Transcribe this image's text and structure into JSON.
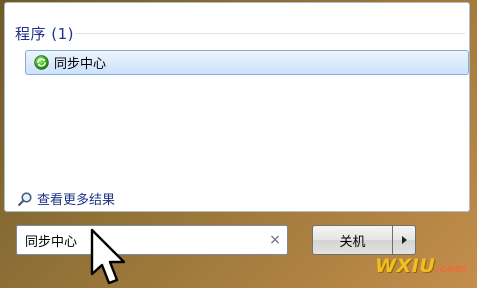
{
  "programs_section": {
    "title": "程序 (1)",
    "items": [
      {
        "label": "同步中心",
        "icon": "sync-center-icon"
      }
    ]
  },
  "see_more": {
    "label": "查看更多结果",
    "icon": "magnifier-icon"
  },
  "search": {
    "value": "同步中心",
    "clear_glyph": "×"
  },
  "shutdown": {
    "label": "关机",
    "arrow_icon": "arrow-right-icon"
  },
  "watermark": {
    "main": "WXIU",
    "sub": ".com"
  },
  "colors": {
    "section_title": "#1e3287",
    "selection_border": "#84acdd",
    "selection_fill": "#dcebfc",
    "watermark_main": "#f0c020",
    "watermark_sub": "#f26a3a"
  }
}
